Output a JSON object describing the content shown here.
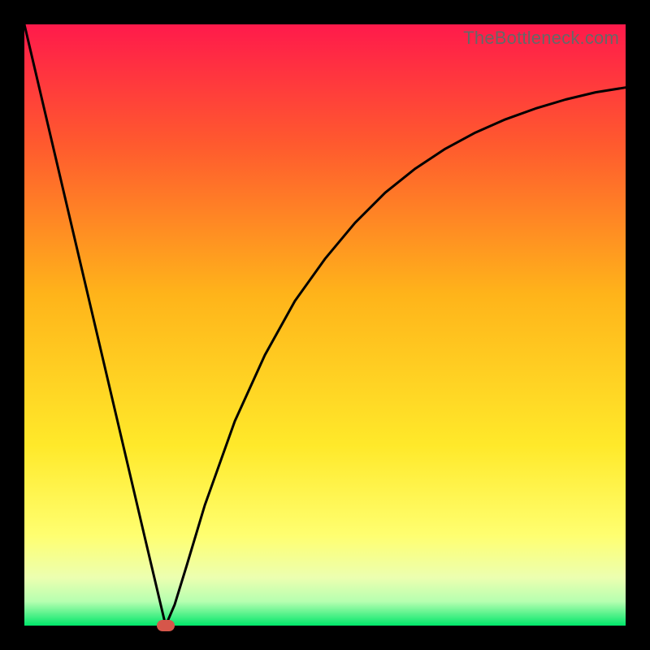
{
  "watermark": "TheBottleneck.com",
  "colors": {
    "gradient_top": "#ff1a4b",
    "gradient_mid_upper": "#ff6a2a",
    "gradient_mid": "#ffd21a",
    "gradient_mid_lower": "#ffff55",
    "gradient_pale": "#f7ffb0",
    "gradient_bottom": "#00e66a",
    "curve": "#000000",
    "marker": "#d6564a"
  },
  "chart_data": {
    "type": "line",
    "title": "",
    "xlabel": "",
    "ylabel": "",
    "xlim": [
      0,
      100
    ],
    "ylim": [
      0,
      100
    ],
    "series": [
      {
        "name": "bottleneck-curve",
        "x": [
          0,
          5,
          10,
          15,
          20,
          23.5,
          25,
          27,
          30,
          35,
          40,
          45,
          50,
          55,
          60,
          65,
          70,
          75,
          80,
          85,
          90,
          95,
          100
        ],
        "y": [
          100,
          78.7,
          57.4,
          36.1,
          14.8,
          0,
          3.5,
          10,
          20,
          34,
          45,
          54,
          61,
          67,
          72,
          76,
          79.3,
          82,
          84.2,
          86,
          87.5,
          88.7,
          89.5
        ]
      }
    ],
    "marker": {
      "x": 23.5,
      "y": 0
    },
    "gradient_stops": [
      {
        "pct": 0,
        "color": "#ff1a4b"
      },
      {
        "pct": 20,
        "color": "#ff5a2e"
      },
      {
        "pct": 45,
        "color": "#ffb41a"
      },
      {
        "pct": 70,
        "color": "#ffe92a"
      },
      {
        "pct": 85,
        "color": "#ffff70"
      },
      {
        "pct": 92,
        "color": "#ecffb0"
      },
      {
        "pct": 96,
        "color": "#b6ffb0"
      },
      {
        "pct": 100,
        "color": "#00e66a"
      }
    ]
  }
}
